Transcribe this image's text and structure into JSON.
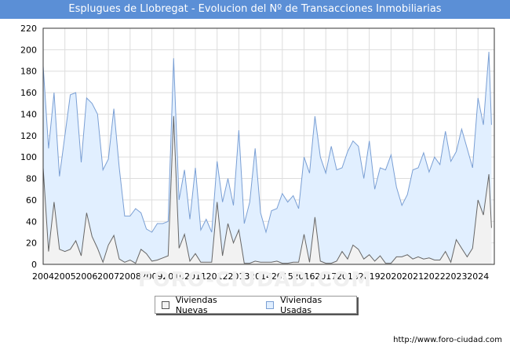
{
  "chart_data": {
    "type": "area",
    "title": "Esplugues de Llobregat - Evolucion del Nº de Transacciones Inmobiliarias",
    "xlabel": "",
    "ylabel": "",
    "ylim": [
      0,
      220
    ],
    "yticks": [
      0,
      20,
      40,
      60,
      80,
      100,
      120,
      140,
      160,
      180,
      200,
      220
    ],
    "xticks": [
      "2004",
      "2005",
      "2006",
      "2007",
      "2008",
      "2009",
      "2010",
      "2011",
      "2012",
      "2013",
      "2014",
      "2015",
      "2016",
      "2017",
      "2018",
      "2019",
      "2020",
      "2021",
      "2022",
      "2023",
      "2024"
    ],
    "grid": true,
    "legend_position": "bottom-center",
    "series": [
      {
        "name": "Viviendas Nuevas",
        "color": "#666666",
        "fill": "#f2f2f2",
        "points": [
          [
            2004.0,
            90
          ],
          [
            2004.25,
            12
          ],
          [
            2004.5,
            58
          ],
          [
            2004.75,
            14
          ],
          [
            2005.0,
            12
          ],
          [
            2005.25,
            14
          ],
          [
            2005.5,
            22
          ],
          [
            2005.75,
            8
          ],
          [
            2006.0,
            48
          ],
          [
            2006.25,
            26
          ],
          [
            2006.5,
            15
          ],
          [
            2006.75,
            2
          ],
          [
            2007.0,
            18
          ],
          [
            2007.25,
            27
          ],
          [
            2007.5,
            5
          ],
          [
            2007.75,
            2
          ],
          [
            2008.0,
            4
          ],
          [
            2008.25,
            1
          ],
          [
            2008.5,
            14
          ],
          [
            2008.75,
            10
          ],
          [
            2009.0,
            3
          ],
          [
            2009.25,
            4
          ],
          [
            2009.5,
            6
          ],
          [
            2009.75,
            8
          ],
          [
            2010.0,
            138
          ],
          [
            2010.25,
            15
          ],
          [
            2010.5,
            28
          ],
          [
            2010.75,
            3
          ],
          [
            2011.0,
            10
          ],
          [
            2011.25,
            2
          ],
          [
            2011.5,
            2
          ],
          [
            2011.75,
            2
          ],
          [
            2012.0,
            58
          ],
          [
            2012.25,
            8
          ],
          [
            2012.5,
            38
          ],
          [
            2012.75,
            20
          ],
          [
            2013.0,
            32
          ],
          [
            2013.25,
            1
          ],
          [
            2013.5,
            1
          ],
          [
            2013.75,
            3
          ],
          [
            2014.0,
            2
          ],
          [
            2014.25,
            2
          ],
          [
            2014.5,
            2
          ],
          [
            2014.75,
            3
          ],
          [
            2015.0,
            1
          ],
          [
            2015.25,
            1
          ],
          [
            2015.5,
            2
          ],
          [
            2015.75,
            2
          ],
          [
            2016.0,
            28
          ],
          [
            2016.25,
            2
          ],
          [
            2016.5,
            44
          ],
          [
            2016.75,
            3
          ],
          [
            2017.0,
            1
          ],
          [
            2017.25,
            1
          ],
          [
            2017.5,
            3
          ],
          [
            2017.75,
            12
          ],
          [
            2018.0,
            5
          ],
          [
            2018.25,
            18
          ],
          [
            2018.5,
            14
          ],
          [
            2018.75,
            5
          ],
          [
            2019.0,
            9
          ],
          [
            2019.25,
            3
          ],
          [
            2019.5,
            8
          ],
          [
            2019.75,
            1
          ],
          [
            2020.0,
            1
          ],
          [
            2020.25,
            7
          ],
          [
            2020.5,
            7
          ],
          [
            2020.75,
            9
          ],
          [
            2021.0,
            5
          ],
          [
            2021.25,
            7
          ],
          [
            2021.5,
            5
          ],
          [
            2021.75,
            6
          ],
          [
            2022.0,
            4
          ],
          [
            2022.25,
            4
          ],
          [
            2022.5,
            12
          ],
          [
            2022.75,
            2
          ],
          [
            2023.0,
            23
          ],
          [
            2023.25,
            15
          ],
          [
            2023.5,
            7
          ],
          [
            2023.75,
            15
          ],
          [
            2024.0,
            60
          ],
          [
            2024.25,
            46
          ],
          [
            2024.5,
            84
          ],
          [
            2024.62,
            34
          ]
        ]
      },
      {
        "name": "Viviendas Usadas",
        "color": "#7a9fd4",
        "fill": "#e1efff",
        "points": [
          [
            2004.0,
            185
          ],
          [
            2004.25,
            108
          ],
          [
            2004.5,
            160
          ],
          [
            2004.75,
            82
          ],
          [
            2005.0,
            120
          ],
          [
            2005.25,
            158
          ],
          [
            2005.5,
            160
          ],
          [
            2005.75,
            95
          ],
          [
            2006.0,
            155
          ],
          [
            2006.25,
            150
          ],
          [
            2006.5,
            140
          ],
          [
            2006.75,
            88
          ],
          [
            2007.0,
            98
          ],
          [
            2007.25,
            145
          ],
          [
            2007.5,
            90
          ],
          [
            2007.75,
            45
          ],
          [
            2008.0,
            45
          ],
          [
            2008.25,
            52
          ],
          [
            2008.5,
            48
          ],
          [
            2008.75,
            33
          ],
          [
            2009.0,
            30
          ],
          [
            2009.25,
            38
          ],
          [
            2009.5,
            38
          ],
          [
            2009.75,
            40
          ],
          [
            2010.0,
            192
          ],
          [
            2010.25,
            60
          ],
          [
            2010.5,
            88
          ],
          [
            2010.75,
            42
          ],
          [
            2011.0,
            90
          ],
          [
            2011.25,
            32
          ],
          [
            2011.5,
            42
          ],
          [
            2011.75,
            30
          ],
          [
            2012.0,
            96
          ],
          [
            2012.25,
            58
          ],
          [
            2012.5,
            80
          ],
          [
            2012.75,
            55
          ],
          [
            2013.0,
            125
          ],
          [
            2013.25,
            38
          ],
          [
            2013.5,
            58
          ],
          [
            2013.75,
            108
          ],
          [
            2014.0,
            48
          ],
          [
            2014.25,
            30
          ],
          [
            2014.5,
            50
          ],
          [
            2014.75,
            52
          ],
          [
            2015.0,
            66
          ],
          [
            2015.25,
            58
          ],
          [
            2015.5,
            64
          ],
          [
            2015.75,
            52
          ],
          [
            2016.0,
            100
          ],
          [
            2016.25,
            85
          ],
          [
            2016.5,
            138
          ],
          [
            2016.75,
            100
          ],
          [
            2017.0,
            85
          ],
          [
            2017.25,
            110
          ],
          [
            2017.5,
            88
          ],
          [
            2017.75,
            90
          ],
          [
            2018.0,
            105
          ],
          [
            2018.25,
            115
          ],
          [
            2018.5,
            110
          ],
          [
            2018.75,
            80
          ],
          [
            2019.0,
            115
          ],
          [
            2019.25,
            70
          ],
          [
            2019.5,
            90
          ],
          [
            2019.75,
            88
          ],
          [
            2020.0,
            102
          ],
          [
            2020.25,
            72
          ],
          [
            2020.5,
            55
          ],
          [
            2020.75,
            65
          ],
          [
            2021.0,
            88
          ],
          [
            2021.25,
            90
          ],
          [
            2021.5,
            104
          ],
          [
            2021.75,
            86
          ],
          [
            2022.0,
            100
          ],
          [
            2022.25,
            93
          ],
          [
            2022.5,
            124
          ],
          [
            2022.75,
            96
          ],
          [
            2023.0,
            105
          ],
          [
            2023.25,
            126
          ],
          [
            2023.5,
            108
          ],
          [
            2023.75,
            90
          ],
          [
            2024.0,
            155
          ],
          [
            2024.25,
            130
          ],
          [
            2024.5,
            198
          ],
          [
            2024.62,
            130
          ]
        ]
      }
    ]
  },
  "legend": {
    "nuevas_label": "Viviendas Nuevas",
    "usadas_label": "Viviendas Usadas"
  },
  "watermark": "FORO-CIUDAD.COM",
  "footer_url": "http://www.foro-ciudad.com"
}
